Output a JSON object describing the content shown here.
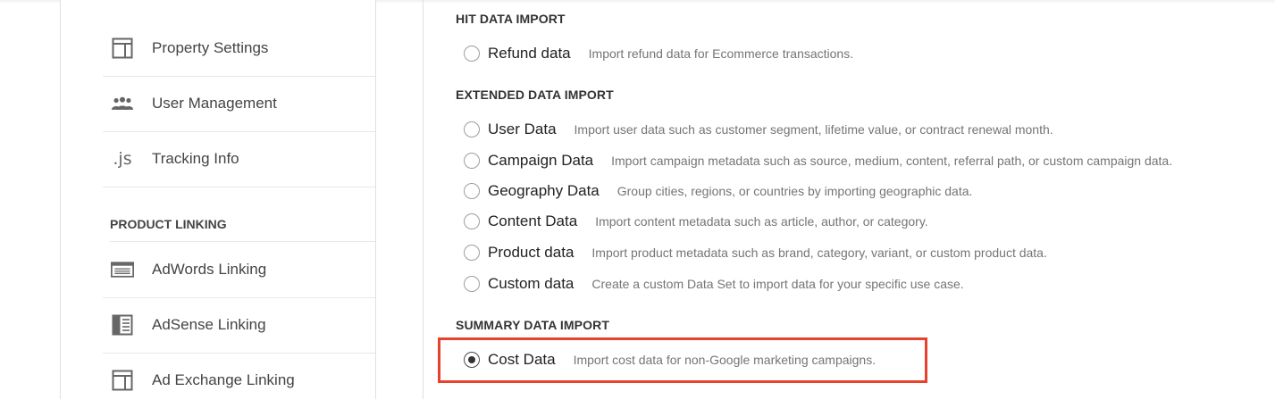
{
  "sidebar": {
    "items": [
      {
        "label": "Property Settings",
        "icon": "property-settings-icon"
      },
      {
        "label": "User Management",
        "icon": "users-icon"
      },
      {
        "label": "Tracking Info",
        "icon": "js-icon",
        "icon_text": ".js"
      }
    ],
    "product_linking": {
      "title": "PRODUCT LINKING",
      "items": [
        {
          "label": "AdWords Linking",
          "icon": "adwords-icon"
        },
        {
          "label": "AdSense Linking",
          "icon": "adsense-icon"
        },
        {
          "label": "Ad Exchange Linking",
          "icon": "ad-exchange-icon"
        }
      ]
    }
  },
  "main": {
    "hit": {
      "title": "HIT DATA IMPORT",
      "options": [
        {
          "label": "Refund data",
          "description": "Import refund data for Ecommerce transactions.",
          "checked": false
        }
      ]
    },
    "extended": {
      "title": "EXTENDED DATA IMPORT",
      "options": [
        {
          "label": "User Data",
          "description": "Import user data such as customer segment, lifetime value, or contract renewal month.",
          "checked": false
        },
        {
          "label": "Campaign Data",
          "description": "Import campaign metadata such as source, medium, content, referral path, or custom campaign data.",
          "checked": false
        },
        {
          "label": "Geography Data",
          "description": "Group cities, regions, or countries by importing geographic data.",
          "checked": false
        },
        {
          "label": "Content Data",
          "description": "Import content metadata such as article, author, or category.",
          "checked": false
        },
        {
          "label": "Product data",
          "description": "Import product metadata such as brand, category, variant, or custom product data.",
          "checked": false
        },
        {
          "label": "Custom data",
          "description": "Create a custom Data Set to import data for your specific use case.",
          "checked": false
        }
      ]
    },
    "summary": {
      "title": "SUMMARY DATA IMPORT",
      "options": [
        {
          "label": "Cost Data",
          "description": "Import cost data for non-Google marketing campaigns.",
          "checked": true
        }
      ]
    }
  },
  "colors": {
    "highlight": "#e8412c",
    "radio_border": "#9e9e9e",
    "description_text": "#757575"
  }
}
